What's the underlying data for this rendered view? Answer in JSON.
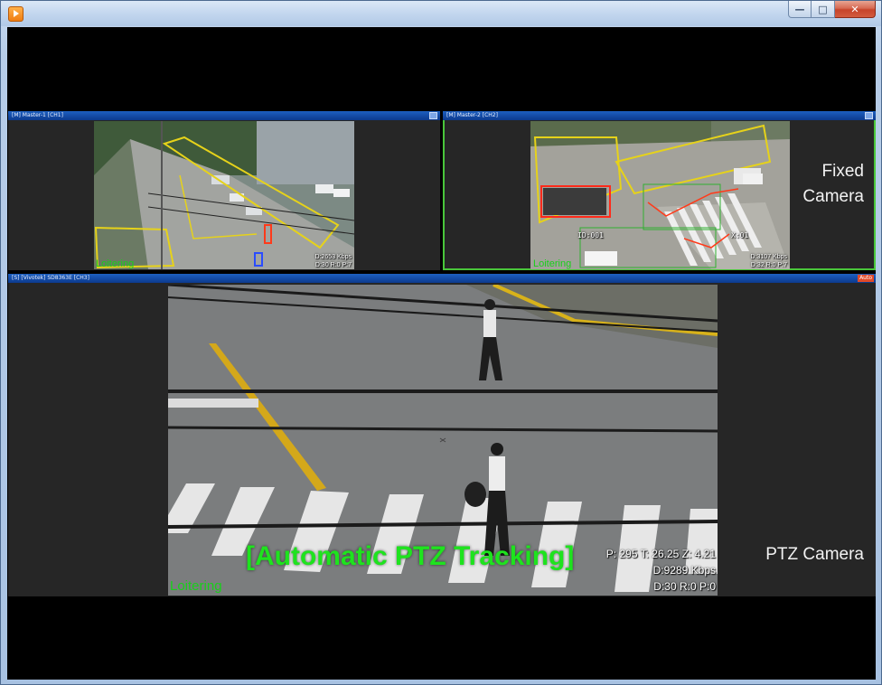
{
  "window": {
    "icon": "media-player-icon",
    "controls": {
      "minimize": "—",
      "maximize": "□",
      "close": "✕"
    }
  },
  "channels": [
    {
      "id": "ch1",
      "title": "[M] Master-1 [CH1]",
      "event": "Loitering",
      "stats_line1": "D:2653 Kbps",
      "stats_line2": "D:30 R:0 P:7"
    },
    {
      "id": "ch2",
      "title": "[M] Master-2 [CH2]",
      "event": "Loitering",
      "stats_line1": "D:3107 Kbps",
      "stats_line2": "D:32 R:0 P:7",
      "track_id": "ID:001",
      "track_id_2": "X:01"
    },
    {
      "id": "ch3",
      "title": "[S] [Vivotek] SD8363E [CH3]",
      "badge": "Auto",
      "event": "Loitering",
      "stats_line0": "P: 295 T: 26.25 Z: 4.21",
      "stats_line1": "D:9289 Kbps",
      "stats_line2": "D:30 R:0 P:0"
    }
  ],
  "labels": {
    "fixed_camera_line1": "Fixed",
    "fixed_camera_line2": "Camera",
    "ptz_camera": "PTZ Camera",
    "tracking_caption": "[Automatic PTZ Tracking]"
  },
  "colors": {
    "pane_bar": "#1450b0",
    "active_border": "#49c63a",
    "loitering_text": "#18d01a",
    "zone_yellow": "#e6d21a",
    "tracking_green": "#1ee31e"
  }
}
